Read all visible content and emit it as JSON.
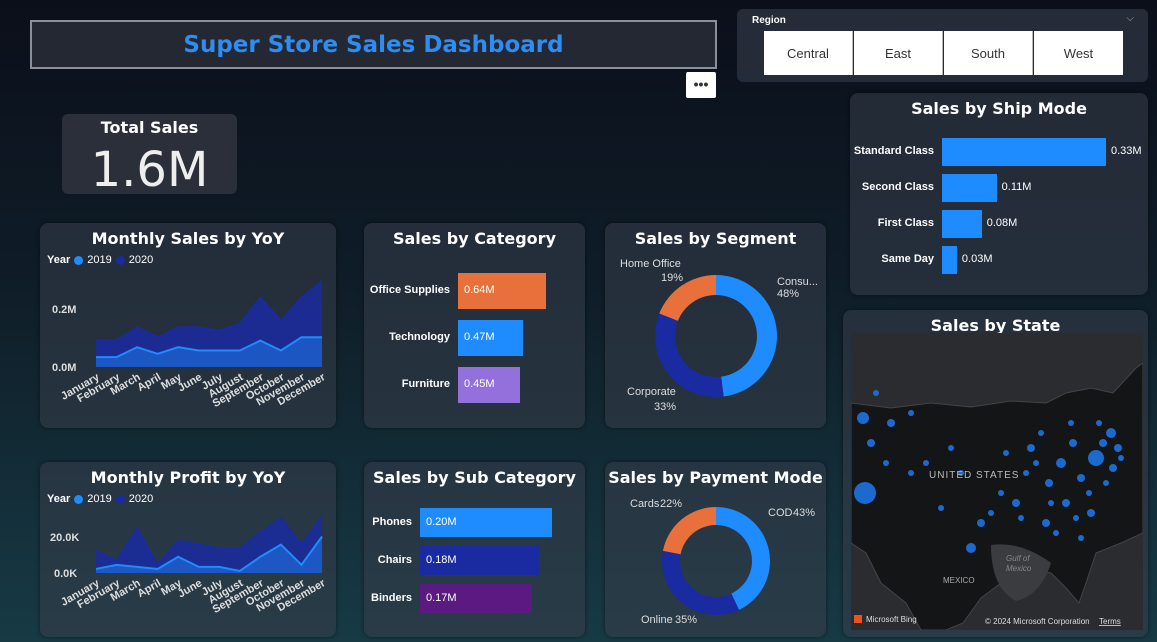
{
  "header": {
    "title": "Super Store Sales Dashboard",
    "more_label": "•••"
  },
  "region": {
    "label": "Region",
    "options": [
      "Central",
      "East",
      "South",
      "West"
    ]
  },
  "kpi": {
    "title": "Total Sales",
    "value": "1.6M"
  },
  "monthly_sales": {
    "title": "Monthly Sales by YoY",
    "legend_title": "Year",
    "y_ticks": [
      "0.2M",
      "0.0M"
    ]
  },
  "monthly_profit": {
    "title": "Monthly Profit by YoY",
    "legend_title": "Year",
    "y_ticks": [
      "20.0K",
      "0.0K"
    ]
  },
  "category": {
    "title": "Sales by Category"
  },
  "sub_category": {
    "title": "Sales by Sub Category"
  },
  "segment": {
    "title": "Sales by Segment"
  },
  "payment": {
    "title": "Sales by Payment Mode"
  },
  "ship_mode": {
    "title": "Sales by Ship Mode"
  },
  "state": {
    "title": "Sales by State",
    "country_label": "UNITED STATES",
    "gulf_label": "Gulf of\nMexico",
    "mexico_label": "MEXICO",
    "bing_label": "Microsoft Bing",
    "copyright": "© 2024 Microsoft Corporation",
    "terms": "Terms"
  },
  "colors": {
    "y2019": "#1e8cff",
    "y2020": "#1a2aa0",
    "office": "#e8703a",
    "tech": "#1e8cff",
    "furniture": "#9370db"
  },
  "chart_data": [
    {
      "type": "area",
      "title": "Monthly Sales by YoY",
      "categories": [
        "January",
        "February",
        "March",
        "April",
        "May",
        "June",
        "July",
        "August",
        "September",
        "October",
        "November",
        "December"
      ],
      "series": [
        {
          "name": "2019",
          "values": [
            0.03,
            0.03,
            0.06,
            0.04,
            0.06,
            0.05,
            0.05,
            0.05,
            0.08,
            0.05,
            0.09,
            0.09
          ]
        },
        {
          "name": "2020",
          "values": [
            0.08,
            0.08,
            0.12,
            0.09,
            0.12,
            0.12,
            0.11,
            0.13,
            0.21,
            0.14,
            0.21,
            0.26
          ]
        }
      ],
      "ylim": [
        0,
        0.3
      ]
    },
    {
      "type": "area",
      "title": "Monthly Profit by YoY",
      "categories": [
        "January",
        "February",
        "March",
        "April",
        "May",
        "June",
        "July",
        "August",
        "September",
        "October",
        "November",
        "December"
      ],
      "series": [
        {
          "name": "2019",
          "values": [
            2,
            4,
            3,
            2,
            8,
            3,
            3,
            1,
            8,
            14,
            4,
            18
          ]
        },
        {
          "name": "2020",
          "values": [
            11,
            6,
            22,
            4,
            16,
            14,
            12,
            12,
            20,
            27,
            14,
            28
          ]
        }
      ],
      "ylim": [
        0,
        35
      ]
    },
    {
      "type": "bar",
      "title": "Sales by Category",
      "categories": [
        "Office Supplies",
        "Technology",
        "Furniture"
      ],
      "values": [
        0.64,
        0.47,
        0.45
      ],
      "labels": [
        "0.64M",
        "0.47M",
        "0.45M"
      ]
    },
    {
      "type": "bar",
      "title": "Sales by Sub Category",
      "categories": [
        "Phones",
        "Chairs",
        "Binders"
      ],
      "values": [
        0.2,
        0.18,
        0.17
      ],
      "labels": [
        "0.20M",
        "0.18M",
        "0.17M"
      ]
    },
    {
      "type": "pie",
      "title": "Sales by Segment",
      "categories": [
        "Consu...",
        "Corporate",
        "Home Office"
      ],
      "values": [
        48,
        33,
        19
      ],
      "labels": [
        "48%",
        "33%",
        "19%"
      ]
    },
    {
      "type": "pie",
      "title": "Sales by Payment Mode",
      "categories": [
        "COD",
        "Online",
        "Cards"
      ],
      "values": [
        43,
        35,
        22
      ],
      "labels": [
        "43%",
        "35%",
        "22%"
      ]
    },
    {
      "type": "bar",
      "title": "Sales by Ship Mode",
      "categories": [
        "Standard Class",
        "Second Class",
        "First Class",
        "Same Day"
      ],
      "values": [
        0.33,
        0.11,
        0.08,
        0.03
      ],
      "labels": [
        "0.33M",
        "0.11M",
        "0.08M",
        "0.03M"
      ]
    }
  ]
}
